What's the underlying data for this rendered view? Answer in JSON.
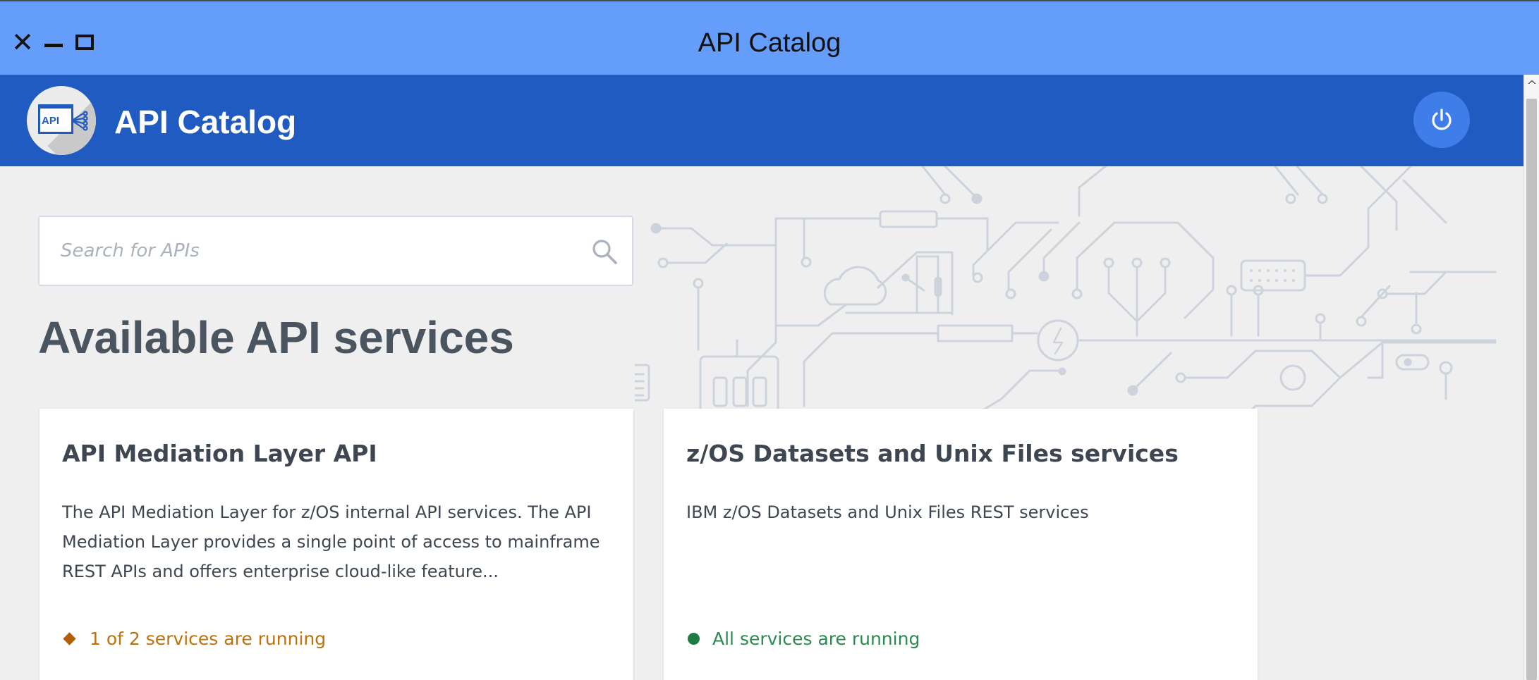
{
  "window": {
    "title": "API Catalog"
  },
  "header": {
    "logo_text": "API",
    "title": "API Catalog"
  },
  "search": {
    "placeholder": "Search for APIs"
  },
  "main": {
    "title": "Available API services"
  },
  "cards": [
    {
      "title": "API Mediation Layer API",
      "description": "The API Mediation Layer for z/OS internal API services. The API Mediation Layer provides a single point of access to mainframe REST APIs and offers enterprise cloud-like feature...",
      "status": "1 of 2 services are running",
      "status_color": "#c0720a"
    },
    {
      "title": "z/OS Datasets and Unix Files services",
      "description": "IBM z/OS Datasets and Unix Files REST services",
      "status": "All services are running",
      "status_color": "#2b8a4f"
    }
  ],
  "colors": {
    "titlebar": "#659dfb",
    "header": "#1f5bc1",
    "background": "#efefef"
  }
}
